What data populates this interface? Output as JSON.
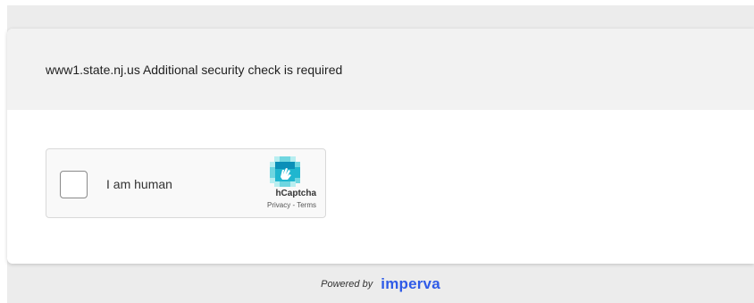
{
  "header": {
    "message": "www1.state.nj.us Additional security check is required"
  },
  "captcha": {
    "checkbox_label": "I am human",
    "brand_name": "hCaptcha",
    "privacy_link": "Privacy",
    "separator": " - ",
    "terms_link": "Terms",
    "logo_icon": "hcaptcha-hand-icon",
    "checked": false
  },
  "footer": {
    "powered_by": "Powered by",
    "vendor": "imperva",
    "vendor_color": "#2f5be7"
  },
  "colors": {
    "page_background": "#ececec",
    "card_background": "#ffffff",
    "header_background": "#f2f2f2",
    "captcha_box_background": "#f9f9f9"
  }
}
